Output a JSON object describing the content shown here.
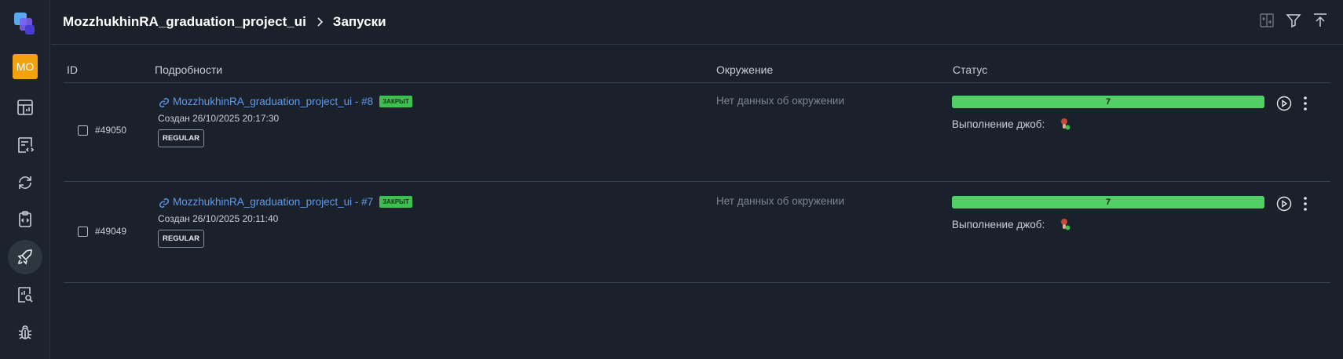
{
  "sidebar": {
    "logo": "app-logo",
    "avatar_initials": "MO",
    "items": [
      {
        "name": "dashboard-icon"
      },
      {
        "name": "test-cases-icon"
      },
      {
        "name": "sync-icon"
      },
      {
        "name": "test-plans-icon"
      },
      {
        "name": "launches-icon",
        "active": true
      },
      {
        "name": "analytics-icon"
      },
      {
        "name": "defects-icon"
      }
    ]
  },
  "header": {
    "project": "MozzhukhinRA_graduation_project_ui",
    "page": "Запуски",
    "icons": [
      "compare-icon",
      "filter-icon",
      "upload-icon"
    ]
  },
  "table": {
    "columns": {
      "id": "ID",
      "details": "Подробности",
      "environment": "Окружение",
      "status": "Статус"
    },
    "rows": [
      {
        "id": "#49050",
        "title": "MozzhukhinRA_graduation_project_ui - #8",
        "badge": "ЗАКРЫТ",
        "created": "Создан 26/10/2025 20:17:30",
        "tag": "REGULAR",
        "environment": "Нет данных об окружении",
        "status_count": "7",
        "jobs_label": "Выполнение джоб:"
      },
      {
        "id": "#49049",
        "title": "MozzhukhinRA_graduation_project_ui - #7",
        "badge": "ЗАКРЫТ",
        "created": "Создан 26/10/2025 20:11:40",
        "tag": "REGULAR",
        "environment": "Нет данных об окружении",
        "status_count": "7",
        "jobs_label": "Выполнение джоб:"
      }
    ]
  },
  "colors": {
    "background": "#1b212a",
    "accent_link": "#5d9bf2",
    "status_green": "#4fd166",
    "avatar": "#f2a20d"
  }
}
